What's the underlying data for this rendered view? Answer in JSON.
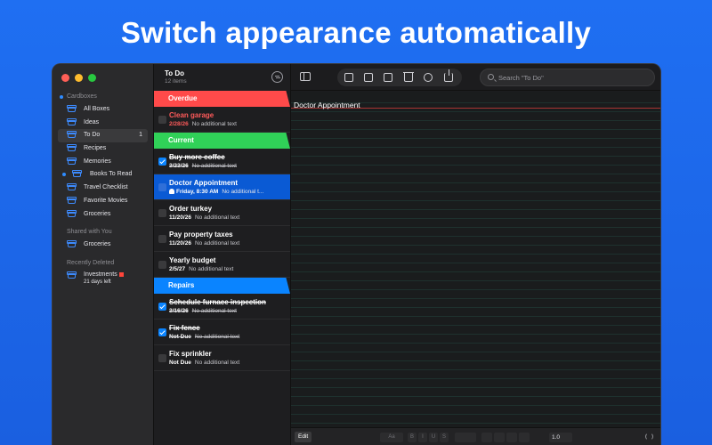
{
  "headline": "Switch appearance automatically",
  "sidebar": {
    "section_cardboxes": "Cardboxes",
    "items": [
      {
        "label": "All Boxes"
      },
      {
        "label": "Ideas"
      },
      {
        "label": "To Do",
        "count": "1"
      },
      {
        "label": "Recipes"
      },
      {
        "label": "Memories"
      },
      {
        "label": "Books To Read"
      },
      {
        "label": "Travel Checklist"
      },
      {
        "label": "Favorite Movies"
      },
      {
        "label": "Groceries"
      }
    ],
    "section_shared": "Shared with You",
    "shared_items": [
      {
        "label": "Groceries"
      }
    ],
    "section_deleted": "Recently Deleted",
    "deleted_items": [
      {
        "label": "Investments",
        "sub": "21 days left"
      }
    ]
  },
  "list": {
    "title": "To Do",
    "count": "12 items",
    "groups": [
      {
        "label": "Overdue",
        "color": "#ff4a4a"
      },
      {
        "label": "Current",
        "color": "#30d158"
      },
      {
        "label": "Repairs",
        "color": "#0a84ff"
      }
    ],
    "rows": [
      {
        "title": "Clean garage",
        "date": "2/28/26",
        "text": "No additional text"
      },
      {
        "title": "Buy more coffee",
        "date": "3/23/26",
        "text": "No additional text"
      },
      {
        "title": "Doctor Appointment",
        "date": "Friday, 8:30 AM",
        "text": "No additional t..."
      },
      {
        "title": "Order turkey",
        "date": "11/20/26",
        "text": "No additional text"
      },
      {
        "title": "Pay property taxes",
        "date": "11/20/26",
        "text": "No additional text"
      },
      {
        "title": "Yearly budget",
        "date": "2/5/27",
        "text": "No additional text"
      },
      {
        "title": "Schedule furnace inspection",
        "date": "3/16/26",
        "text": "No additional text"
      },
      {
        "title": "Fix fence",
        "date": "Not Due",
        "text": "No additional text"
      },
      {
        "title": "Fix sprinkler",
        "date": "Not Due",
        "text": "No additional text"
      }
    ]
  },
  "editor": {
    "search_placeholder": "Search \"To Do\"",
    "note_title": "Doctor Appointment",
    "edit_label": "Edit",
    "font_label": "Aa",
    "bold": "B",
    "italic": "I",
    "underline": "U",
    "strike": "S",
    "zoom": "1.0"
  }
}
